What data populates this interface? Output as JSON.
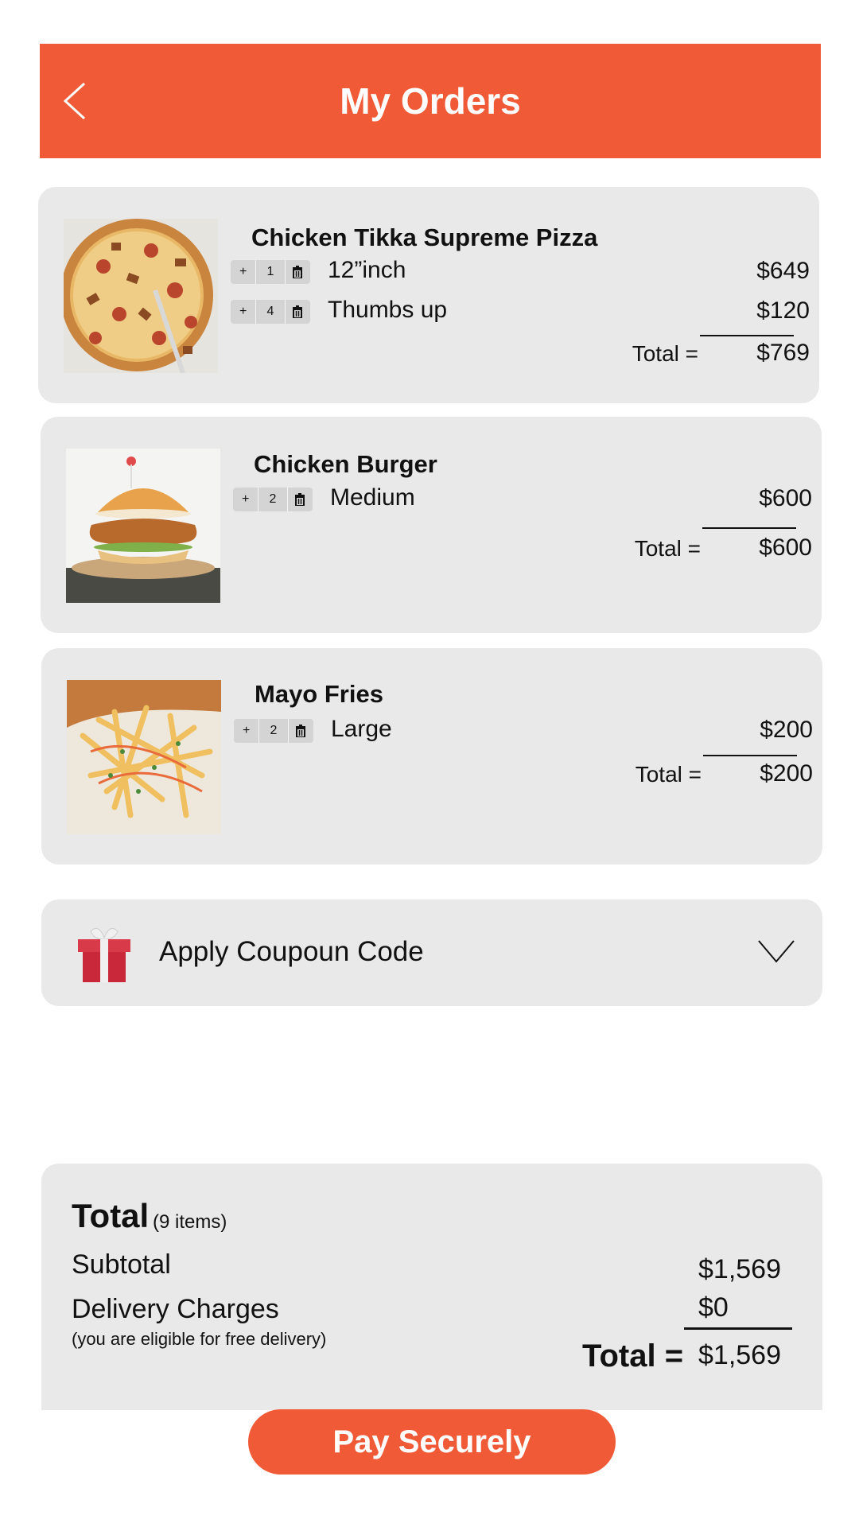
{
  "header": {
    "title": "My Orders",
    "back_icon": "chevron-left-icon"
  },
  "orders": [
    {
      "name": "Chicken Tikka Supreme Pizza",
      "image": "pizza-image",
      "options": [
        {
          "label": "12”inch",
          "qty": "1",
          "price": "$649"
        },
        {
          "label": "Thumbs up",
          "qty": "4",
          "price": "$120"
        }
      ],
      "total_label": "Total =",
      "total": "$769"
    },
    {
      "name": "Chicken Burger",
      "image": "burger-image",
      "options": [
        {
          "label": "Medium",
          "qty": "2",
          "price": "$600"
        }
      ],
      "total_label": "Total =",
      "total": "$600"
    },
    {
      "name": "Mayo Fries",
      "image": "fries-image",
      "options": [
        {
          "label": "Large",
          "qty": "2",
          "price": "$200"
        }
      ],
      "total_label": "Total =",
      "total": "$200"
    }
  ],
  "stepper": {
    "plus": "+",
    "trash_icon": "trash-icon"
  },
  "coupon": {
    "label": "Apply Coupoun Code",
    "icon": "gift-icon",
    "toggle_icon": "chevron-down-icon"
  },
  "summary": {
    "title": "Total",
    "count": "(9 items)",
    "subtotal_label": "Subtotal",
    "subtotal": "$1,569",
    "delivery_label": "Delivery Charges",
    "delivery_note": "(you are eligible for free delivery)",
    "delivery": "$0",
    "total_label": "Total =",
    "total": "$1,569"
  },
  "pay_button": "Pay Securely",
  "colors": {
    "accent": "#f05a36",
    "card": "#e9e9e9",
    "stepper": "#d4d4d4"
  }
}
